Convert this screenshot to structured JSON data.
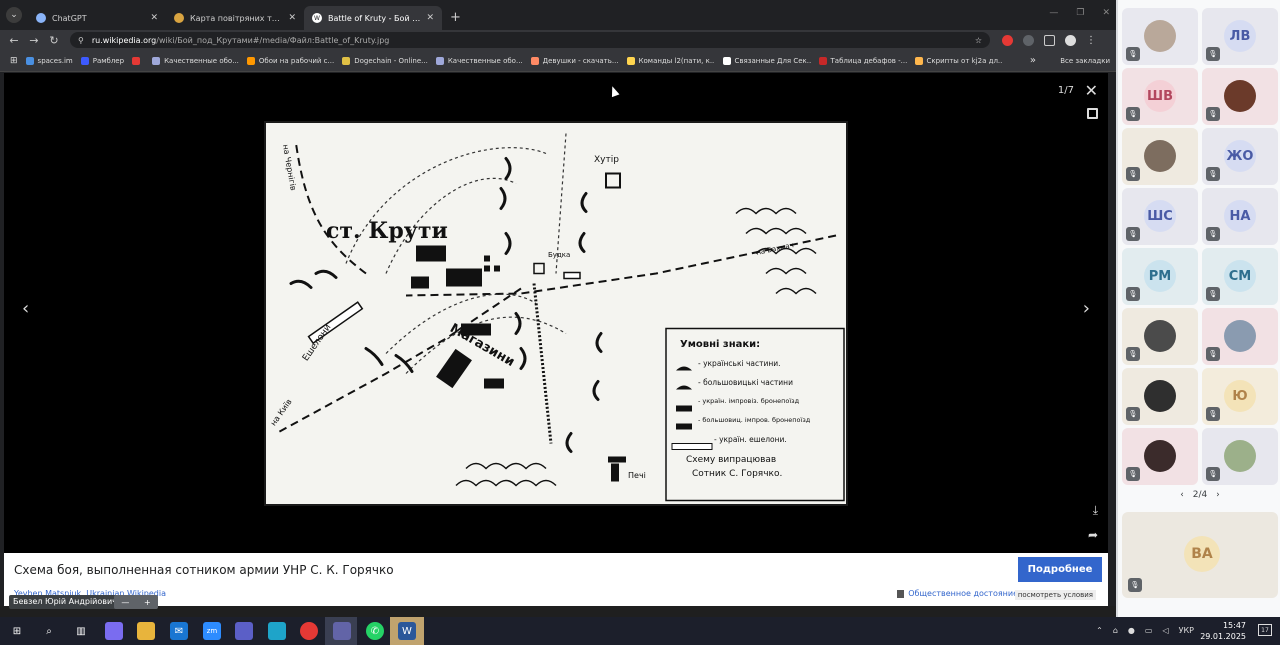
{
  "browser": {
    "tabs": [
      {
        "title": "ChatGPT",
        "fav_color": "#ffffff",
        "active": false
      },
      {
        "title": "Карта повітряних тривог Укр...",
        "fav_color": "#d9a441",
        "active": false
      },
      {
        "title": "Battle of Kruty - Бой под Круто...",
        "fav_color": "#ffffff",
        "active": true
      }
    ],
    "url_host": "ru.wikipedia.org",
    "url_path": "/wiki/Бой_под_Крутами#/media/Файл:Battle_of_Kruty.jpg",
    "bookmarks": [
      {
        "label": "spaces.im",
        "color": "#4a90e2"
      },
      {
        "label": "Рамблер",
        "color": "#3d5afe"
      },
      {
        "label": "",
        "color": "#e53935"
      },
      {
        "label": "Качественные обо...",
        "color": "#9fa8da"
      },
      {
        "label": "Обои на рабочий с...",
        "color": "#ff9800"
      },
      {
        "label": "Dogechain - Online...",
        "color": "#e0c045"
      },
      {
        "label": "Качественные обо...",
        "color": "#9fa8da"
      },
      {
        "label": "Девушки - скачать...",
        "color": "#ff8a65"
      },
      {
        "label": "Команды l2(пати, к...",
        "color": "#ffd54f"
      },
      {
        "label": "Связанные Для Сек...",
        "color": "#ffffff"
      },
      {
        "label": "Таблица дебафов -...",
        "color": "#c62828"
      },
      {
        "label": "Скрипты от kj2a дл...",
        "color": "#ffb74d"
      }
    ],
    "bookmarks_all": "Все закладки"
  },
  "viewer": {
    "counter": "1/7",
    "caption": "Схема боя, выполненная сотником армии УНР С. К. Горячко",
    "more_button": "Подробнее",
    "author": "Yevhen Matsniuk, Ukrainian Wikipedia",
    "license": "Общественное достояние",
    "terms": "посмотреть условия",
    "speaker": "Бевзел Юрій Андрійович",
    "map": {
      "station": "ст. Крути",
      "khutir": "Хутір",
      "budka": "Будка",
      "magazyny": "Магазини",
      "echelony": "Ешелони",
      "na_kyiv": "на Київ",
      "na_chernihiv": "на Чернігів",
      "na_bakhmach": "на Бахмач",
      "pechi": "Печі",
      "legend_title": "Умовні знаки:",
      "legend": [
        "- українські частини.",
        "- большовицькі частини",
        "- україн. імпровіз. бронепоїзд",
        "- большовиц. імпров. бронепоїзд",
        "- україн. ешелони."
      ],
      "author_note_1": "Схему випрацював",
      "author_note_2": "Сотник С. Горячко."
    }
  },
  "meet": {
    "participants": [
      {
        "initials": "",
        "bg": "#e8e8ef",
        "avatar": "#b9a89a"
      },
      {
        "initials": "ЛВ",
        "bg": "#e7e7ee",
        "avatar": "#d6dcf2",
        "fg": "#4a5ba5"
      },
      {
        "initials": "ШВ",
        "bg": "#f2e1e4",
        "avatar": "#f4d0d6",
        "fg": "#b2475e"
      },
      {
        "initials": "",
        "bg": "#f2e1e4",
        "avatar": "#6b3a2a"
      },
      {
        "initials": "",
        "bg": "#efeae0",
        "avatar": "#7d6d5f"
      },
      {
        "initials": "ЖО",
        "bg": "#e7e7ee",
        "avatar": "#d6dcf2",
        "fg": "#4a5ba5"
      },
      {
        "initials": "ШС",
        "bg": "#e7e7ee",
        "avatar": "#d6dcf2",
        "fg": "#4a5ba5"
      },
      {
        "initials": "НА",
        "bg": "#e7e7ee",
        "avatar": "#d6dcf2",
        "fg": "#4a5ba5"
      },
      {
        "initials": "РМ",
        "bg": "#e2ecef",
        "avatar": "#cbe3ee",
        "fg": "#2e6f8e"
      },
      {
        "initials": "СМ",
        "bg": "#e2ecef",
        "avatar": "#cbe3ee",
        "fg": "#2e6f8e"
      },
      {
        "initials": "",
        "bg": "#efeae0",
        "avatar": "#4b4b4b"
      },
      {
        "initials": "",
        "bg": "#f2e1e4",
        "avatar": "#8a9bb0"
      },
      {
        "initials": "",
        "bg": "#efeae0",
        "avatar": "#2f2f2f"
      },
      {
        "initials": "Ю",
        "bg": "#f3ecdc",
        "avatar": "#f3e3b8",
        "fg": "#b0834a"
      },
      {
        "initials": "",
        "bg": "#f2e1e4",
        "avatar": "#3b2b2b"
      },
      {
        "initials": "",
        "bg": "#e7e7ee",
        "avatar": "#9cb08a"
      }
    ],
    "pager": "2/4",
    "featured": "ВА"
  },
  "taskbar": {
    "lang": "УКР",
    "time": "15:47",
    "date": "29.01.2025",
    "notif_count": "17"
  }
}
